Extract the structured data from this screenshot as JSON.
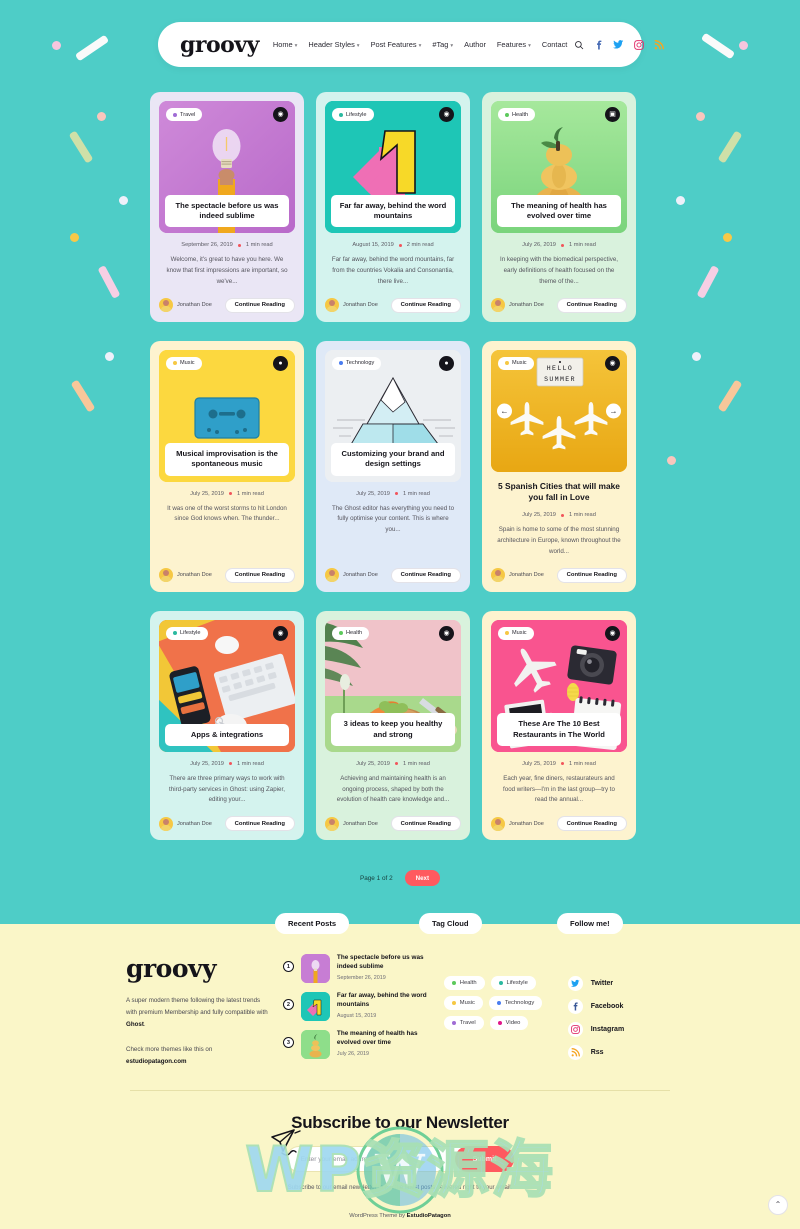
{
  "theme": {
    "bg_teal": "#4ecdc7",
    "accent_red": "#ff5a5f",
    "footer_cream": "#faf6c8"
  },
  "header": {
    "logo": "groovy",
    "nav": [
      {
        "label": "Home",
        "caret": true
      },
      {
        "label": "Header Styles",
        "caret": true
      },
      {
        "label": "Post Features",
        "caret": true
      },
      {
        "label": "#Tag",
        "caret": true
      },
      {
        "label": "Author",
        "caret": false
      },
      {
        "label": "Features",
        "caret": true
      },
      {
        "label": "Contact",
        "caret": false
      }
    ],
    "icons": [
      "search-icon",
      "facebook-icon",
      "twitter-icon",
      "instagram-icon",
      "rss-icon"
    ]
  },
  "posts": [
    {
      "category": "Travel",
      "cat_color": "#a06cd5",
      "title": "The spectacle before us was indeed sublime",
      "date": "September 26, 2019",
      "read_time": "1 min read",
      "excerpt": "Welcome, it's great to have you here. We know that first impressions are important, so we've...",
      "author": "Jonathan Doe",
      "cta": "Continue Reading",
      "card_bg": "#eae6f5",
      "thumb_bg": "#c77dd4",
      "format_icon": "camera-icon",
      "title_overlay": true,
      "carousel": false,
      "art": "lightbulb-hand"
    },
    {
      "category": "Lifestyle",
      "cat_color": "#2bb9a0",
      "title": "Far far away, behind the word mountains",
      "date": "August 15, 2019",
      "read_time": "2 min read",
      "excerpt": "Far far away, behind the word mountains, far from the countries Vokalia and Consonantia, there live...",
      "author": "Jonathan Doe",
      "cta": "Continue Reading",
      "card_bg": "#d4f3ee",
      "thumb_bg": "#1ec6b6",
      "format_icon": "camera-icon",
      "title_overlay": true,
      "carousel": false,
      "art": "number-one"
    },
    {
      "category": "Health",
      "cat_color": "#5cc95c",
      "title": "The meaning of health has evolved over time",
      "date": "July 26, 2019",
      "read_time": "1 min read",
      "excerpt": "In keeping with the biomedical perspective, early definitions of health focused on the theme of the...",
      "author": "Jonathan Doe",
      "cta": "Continue Reading",
      "card_bg": "#d9f2dd",
      "thumb_bg": "#8ede8a",
      "format_icon": "gallery-icon",
      "title_overlay": true,
      "carousel": false,
      "art": "pumpkins"
    },
    {
      "category": "Music",
      "cat_color": "#f6c844",
      "title": "Musical improvisation is the spontaneous music",
      "date": "July 25, 2019",
      "read_time": "1 min read",
      "excerpt": "It was one of the worst storms to hit London since God knows when. The thunder...",
      "author": "Jonathan Doe",
      "cta": "Continue Reading",
      "card_bg": "#fdf3cf",
      "thumb_bg": "#fcd83f",
      "format_icon": "audio-icon",
      "title_overlay": true,
      "carousel": false,
      "art": "cassette"
    },
    {
      "category": "Technology",
      "cat_color": "#4a7df0",
      "title": "Customizing your brand and design settings",
      "date": "July 25, 2019",
      "read_time": "1 min read",
      "excerpt": "The Ghost editor has everything you need to fully optimise your content. This is where you...",
      "author": "Jonathan Doe",
      "cta": "Continue Reading",
      "card_bg": "#dfe9f7",
      "thumb_bg": "#eceff2",
      "format_icon": "video-icon",
      "title_overlay": true,
      "carousel": false,
      "art": "iceberg"
    },
    {
      "category": "Music",
      "cat_color": "#f6c844",
      "title": "5 Spanish Cities that will make you fall in Love",
      "date": "July 25, 2019",
      "read_time": "1 min read",
      "excerpt": "Spain is home to some of the most stunning architecture in Europe, known throughout the world...",
      "author": "Jonathan Doe",
      "cta": "Continue Reading",
      "card_bg": "#fdf3cf",
      "thumb_bg": "#f0b72a",
      "format_icon": "camera-icon",
      "title_overlay": false,
      "carousel": true,
      "art": "planes-summer",
      "prev_label": "←",
      "next_label": "→"
    },
    {
      "category": "Lifestyle",
      "cat_color": "#2bb9a0",
      "title": "Apps & integrations",
      "date": "July 25, 2019",
      "read_time": "1 min read",
      "excerpt": "There are three primary ways to work with third-party services in Ghost: using Zapier, editing your...",
      "author": "Jonathan Doe",
      "cta": "Continue Reading",
      "card_bg": "#d4f3ee",
      "thumb_bg": "#f07b45",
      "format_icon": "camera-icon",
      "title_overlay": true,
      "carousel": false,
      "art": "desk-flatlay"
    },
    {
      "category": "Health",
      "cat_color": "#5cc95c",
      "title": "3 ideas to keep you healthy and strong",
      "date": "July 25, 2019",
      "read_time": "1 min read",
      "excerpt": "Achieving and maintaining health is an ongoing process, shaped by both the evolution of health care knowledge and...",
      "author": "Jonathan Doe",
      "cta": "Continue Reading",
      "card_bg": "#d9f2dd",
      "thumb_bg": "#f3c9ce",
      "format_icon": "camera-icon",
      "title_overlay": true,
      "carousel": false,
      "art": "veggies"
    },
    {
      "category": "Music",
      "cat_color": "#f6c844",
      "title": "These Are The 10 Best Restaurants in The World",
      "date": "July 25, 2019",
      "read_time": "1 min read",
      "excerpt": "Each year, fine diners, restaurateurs and food writers—I'm in the last group—try to read the annual...",
      "author": "Jonathan Doe",
      "cta": "Continue Reading",
      "card_bg": "#fdf3cf",
      "thumb_bg": "#f9548f",
      "format_icon": "camera-icon",
      "title_overlay": true,
      "carousel": false,
      "art": "travel-flatlay"
    }
  ],
  "pagination": {
    "page_label": "Page 1 of 2",
    "next_label": "Next"
  },
  "footer": {
    "logo": "groovy",
    "about_line1": "A super modern theme following the latest trends with premium Membership and fully compatible with ",
    "about_brand": "Ghost",
    "about_line1_end": ".",
    "about_line2": "Check more themes like this on ",
    "about_link": "estudiopatagon.com",
    "recent_title": "Recent Posts",
    "recent": [
      {
        "num": "1",
        "title": "The spectacle before us was indeed sublime",
        "date": "September 26, 2019",
        "bg": "#c77dd4"
      },
      {
        "num": "2",
        "title": "Far far away, behind the word mountains",
        "date": "August 15, 2019",
        "bg": "#1ec6b6"
      },
      {
        "num": "3",
        "title": "The meaning of health has evolved over time",
        "date": "July 26, 2019",
        "bg": "#8ede8a"
      }
    ],
    "tag_title": "Tag Cloud",
    "tags": [
      {
        "label": "Health",
        "color": "#5cc95c"
      },
      {
        "label": "Lifestyle",
        "color": "#2bb9a0"
      },
      {
        "label": "Music",
        "color": "#f6c844"
      },
      {
        "label": "Technology",
        "color": "#4a7df0"
      },
      {
        "label": "Travel",
        "color": "#a06cd5"
      },
      {
        "label": "Video",
        "color": "#e0178a"
      }
    ],
    "follow_title": "Follow me!",
    "follow": [
      {
        "label": "Twitter",
        "icon": "twitter-icon",
        "color": "#1da1f2"
      },
      {
        "label": "Facebook",
        "icon": "facebook-icon",
        "color": "#3b5998"
      },
      {
        "label": "Instagram",
        "icon": "instagram-icon",
        "color": "#e1306c"
      },
      {
        "label": "Rss",
        "icon": "rss-icon",
        "color": "#f5a623"
      }
    ]
  },
  "newsletter": {
    "heading": "Subscribe to our Newsletter",
    "placeholder": "Enter your email address",
    "value": "",
    "submit_label": "Submit",
    "note": "Subscribe to our email newsletter to get the latest posts delivered right to your email."
  },
  "credit": {
    "prefix": "WordPress Theme by ",
    "brand": "EstudioPatagon"
  },
  "watermark": {
    "text": "WP资源海"
  },
  "to_top": {
    "glyph": "⌃"
  }
}
